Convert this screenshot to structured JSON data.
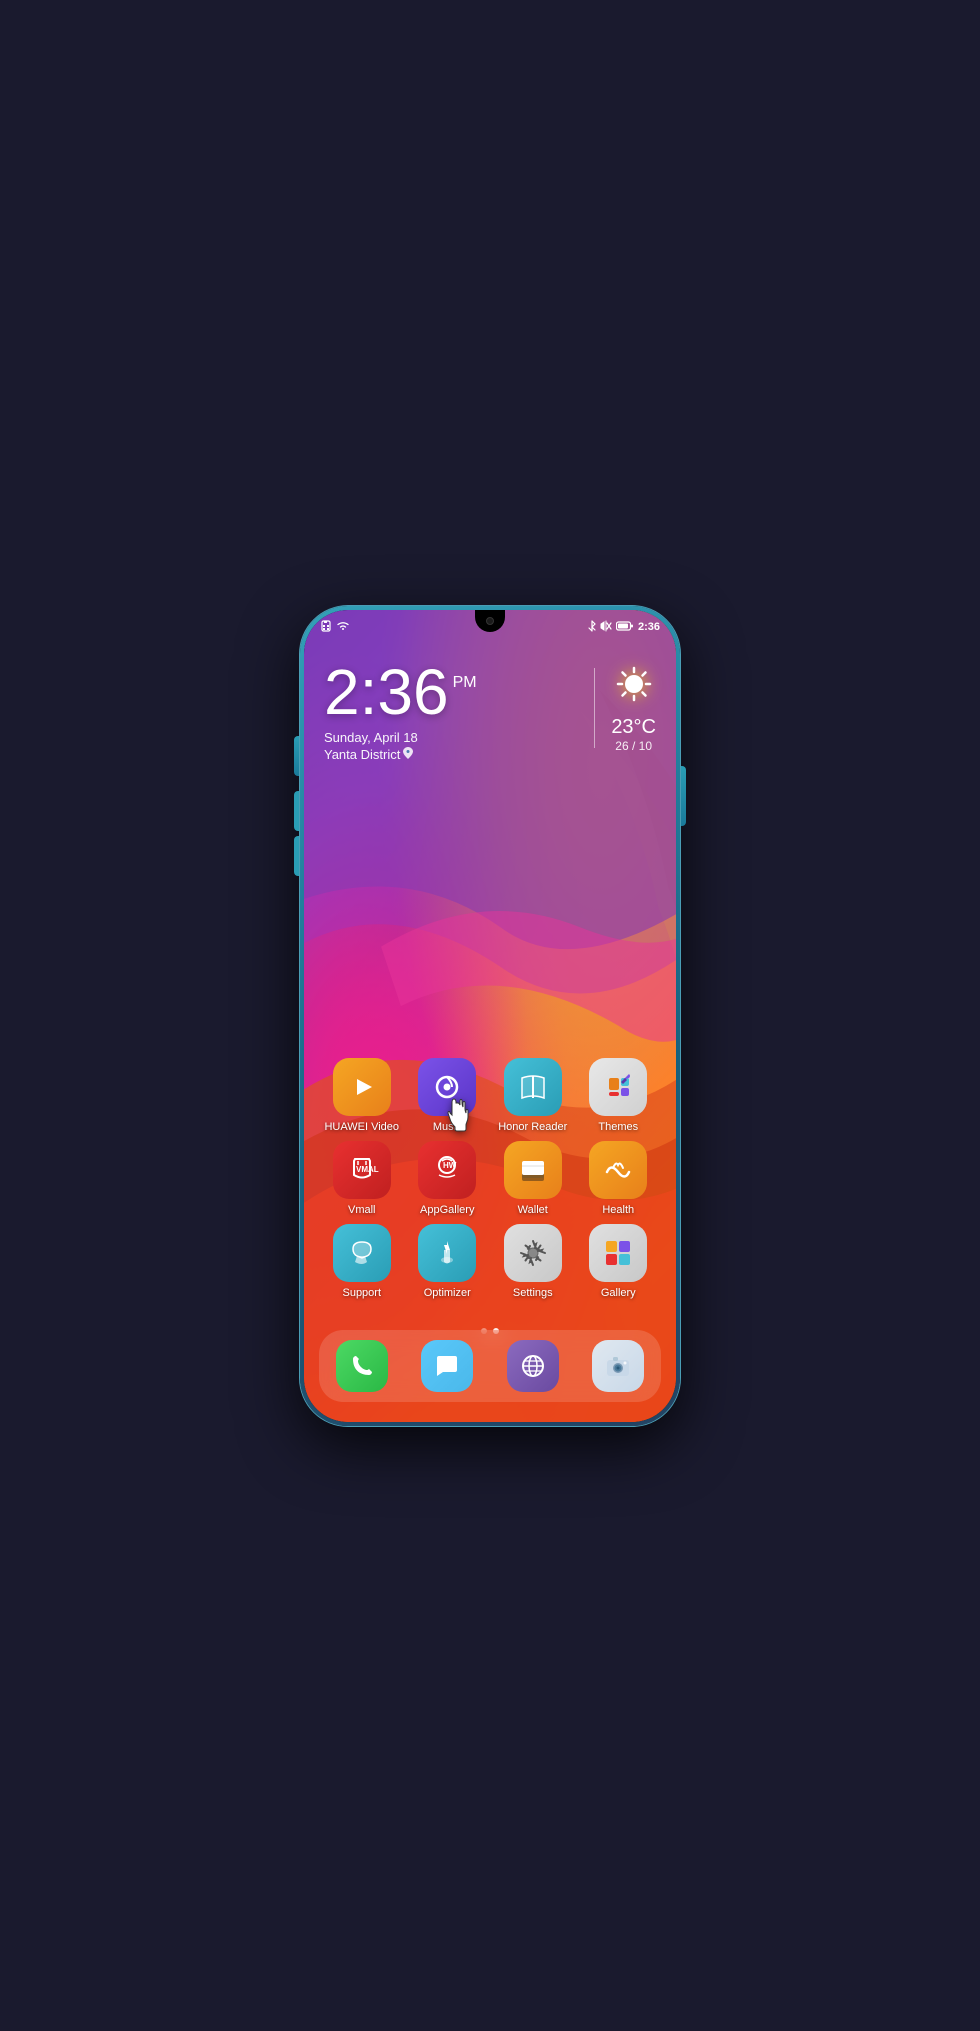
{
  "phone": {
    "status_bar": {
      "time": "2:36",
      "icons_left": [
        "sim",
        "wifi"
      ],
      "icons_right": [
        "bluetooth",
        "mute",
        "battery",
        "time_right"
      ],
      "time_right_label": "2:36"
    },
    "clock": {
      "time": "2:36",
      "ampm": "PM",
      "date": "Sunday, April 18",
      "location": "Yanta District"
    },
    "weather": {
      "temp": "23°C",
      "range": "26 / 10"
    },
    "apps": [
      {
        "id": "huawei-video",
        "label": "HUAWEI Video",
        "color_class": "app-huawei-video"
      },
      {
        "id": "music",
        "label": "Music",
        "color_class": "app-music"
      },
      {
        "id": "honor-reader",
        "label": "Honor Reader",
        "color_class": "app-honor-reader"
      },
      {
        "id": "themes",
        "label": "Themes",
        "color_class": "app-themes"
      },
      {
        "id": "vmall",
        "label": "Vmall",
        "color_class": "app-vmall"
      },
      {
        "id": "appgallery",
        "label": "AppGallery",
        "color_class": "app-appgallery"
      },
      {
        "id": "wallet",
        "label": "Wallet",
        "color_class": "app-wallet"
      },
      {
        "id": "health",
        "label": "Health",
        "color_class": "app-health"
      },
      {
        "id": "support",
        "label": "Support",
        "color_class": "app-support"
      },
      {
        "id": "optimizer",
        "label": "Optimizer",
        "color_class": "app-optimizer"
      },
      {
        "id": "settings",
        "label": "Settings",
        "color_class": "app-settings"
      },
      {
        "id": "gallery",
        "label": "Gallery",
        "color_class": "app-gallery"
      }
    ],
    "dock_apps": [
      {
        "id": "phone",
        "color_class": "dock-phone"
      },
      {
        "id": "messages",
        "color_class": "dock-messages"
      },
      {
        "id": "browser",
        "color_class": "dock-browser"
      },
      {
        "id": "camera",
        "color_class": "dock-camera"
      }
    ],
    "page_dots": [
      {
        "active": false
      },
      {
        "active": true
      }
    ]
  }
}
